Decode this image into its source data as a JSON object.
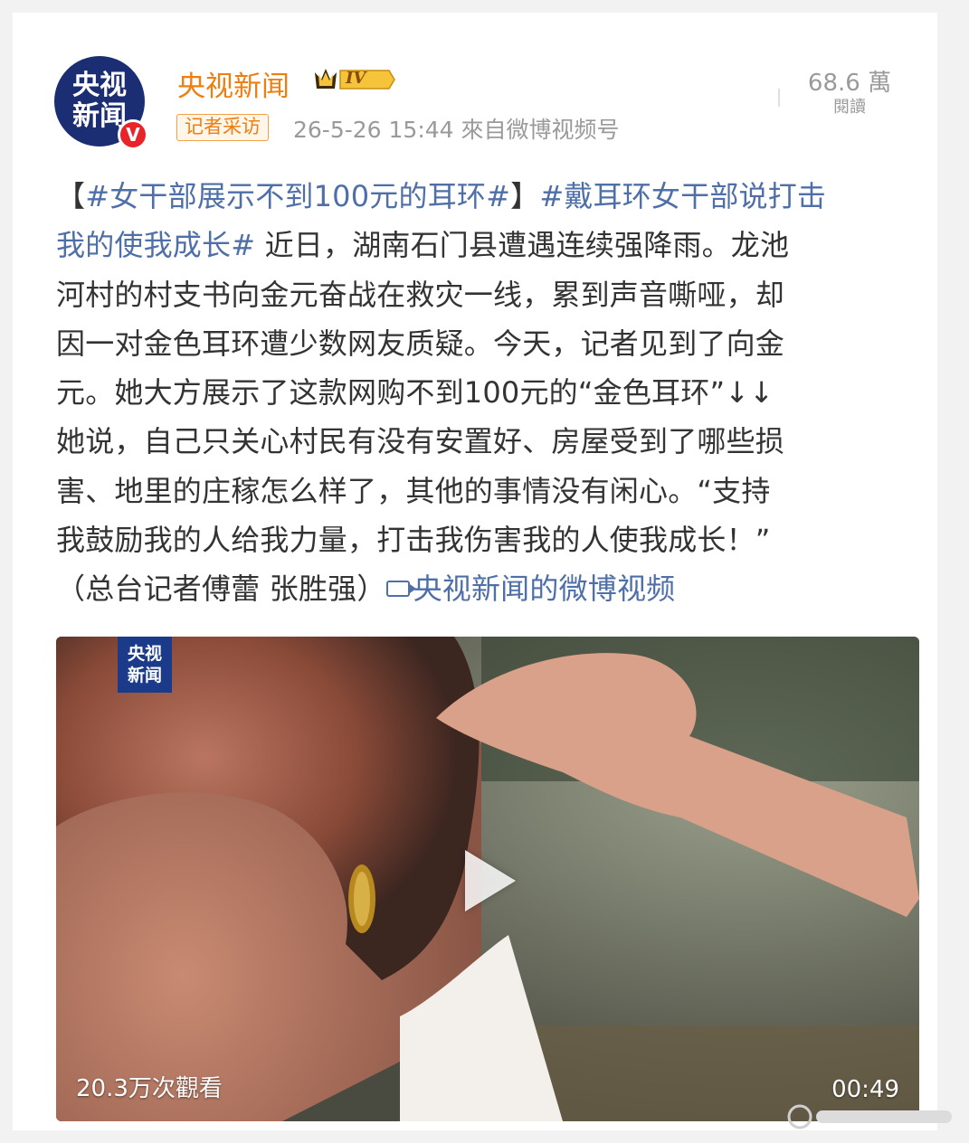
{
  "post": {
    "author": "央视新闻",
    "level_badge": "IV",
    "tag": "记者采访",
    "timestamp": "26-5-26 15:44",
    "source": "來自微博视频号",
    "views_count": "68.6 萬",
    "views_label": "閱讀",
    "avatar_text_line1": "央视",
    "avatar_text_line2": "新闻",
    "verified_mark": "V"
  },
  "content": {
    "lines": [
      [
        {
          "t": "【",
          "c": "n"
        },
        {
          "t": "#女干部展示不到100元的耳环#",
          "c": "topic"
        },
        {
          "t": "】",
          "c": "n"
        },
        {
          "t": "#戴耳环女干部说打击",
          "c": "topic"
        }
      ],
      [
        {
          "t": "我的使我成长#",
          "c": "topic"
        },
        {
          "t": " 近日，湖南石门县遭遇连续强降雨。龙池",
          "c": "n"
        }
      ],
      [
        {
          "t": "河村的村支书向金元奋战在救灾一线，累到声音嘶哑，却",
          "c": "n"
        }
      ],
      [
        {
          "t": "因一对金色耳环遭少数网友质疑。今天，记者见到了向金",
          "c": "n"
        }
      ],
      [
        {
          "t": "元。她大方展示了这款网购不到100元的“金色耳环”↓↓",
          "c": "n"
        }
      ],
      [
        {
          "t": "她说，自己只关心村民有没有安置好、房屋受到了哪些损",
          "c": "n"
        }
      ],
      [
        {
          "t": "害、地里的庄稼怎么样了，其他的事情没有闲心。“支持",
          "c": "n"
        }
      ],
      [
        {
          "t": "我鼓励我的人给我力量，打击我伤害我的人使我成长！”",
          "c": "n"
        }
      ],
      [
        {
          "t": "（总台记者傅蕾 张胜强）",
          "c": "n"
        },
        {
          "t": "央视新闻的微博视频",
          "c": "link"
        }
      ]
    ]
  },
  "video": {
    "logo_line1": "央视",
    "logo_line2": "新闻",
    "play_count": "20.3万次觀看",
    "duration": "00:49",
    "play_icon": "play-icon"
  },
  "colors": {
    "author": "#f07d10",
    "topic": "#4f6fa8",
    "text": "#333333",
    "meta": "#9a9a9a"
  }
}
